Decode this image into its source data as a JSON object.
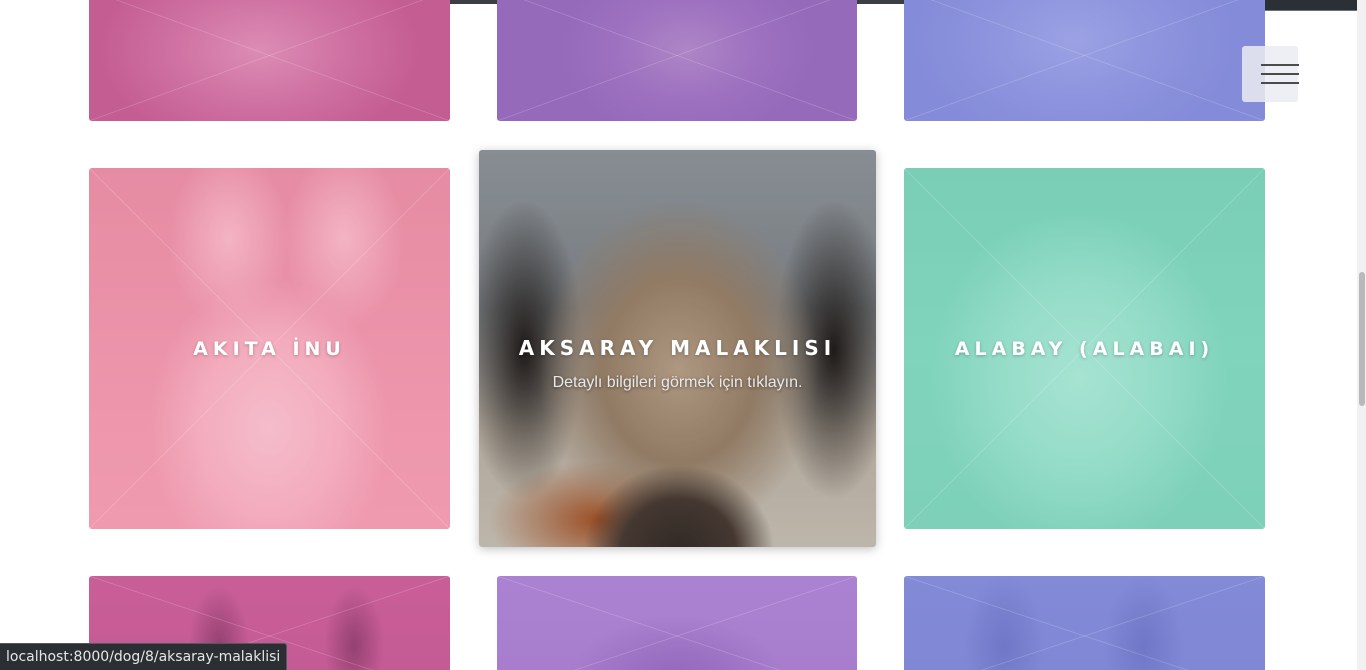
{
  "cards": {
    "top_left": {
      "title": ""
    },
    "top_middle": {
      "title": ""
    },
    "top_right": {
      "title": ""
    },
    "akita": {
      "title": "AKITA İNU"
    },
    "aksaray": {
      "title": "AKSARAY MALAKLISI",
      "subtitle": "Detaylı bilgileri görmek için tıklayın."
    },
    "alabay": {
      "title": "ALABAY (ALABAI)"
    },
    "bottom_left": {
      "title": ""
    },
    "bottom_middle": {
      "title": ""
    },
    "bottom_right": {
      "title": ""
    }
  },
  "menu": {
    "icon": "hamburger-menu-icon"
  },
  "status_bar": {
    "link_url": "localhost:8000/dog/8/aksaray-malaklisi"
  },
  "colors": {
    "pink_magenta": "#c75b95",
    "violet": "#a67ccd",
    "blue_violet": "#8c92dd",
    "pink": "#ee8fa6",
    "teal": "#7fd4bd",
    "white": "#ffffff"
  }
}
